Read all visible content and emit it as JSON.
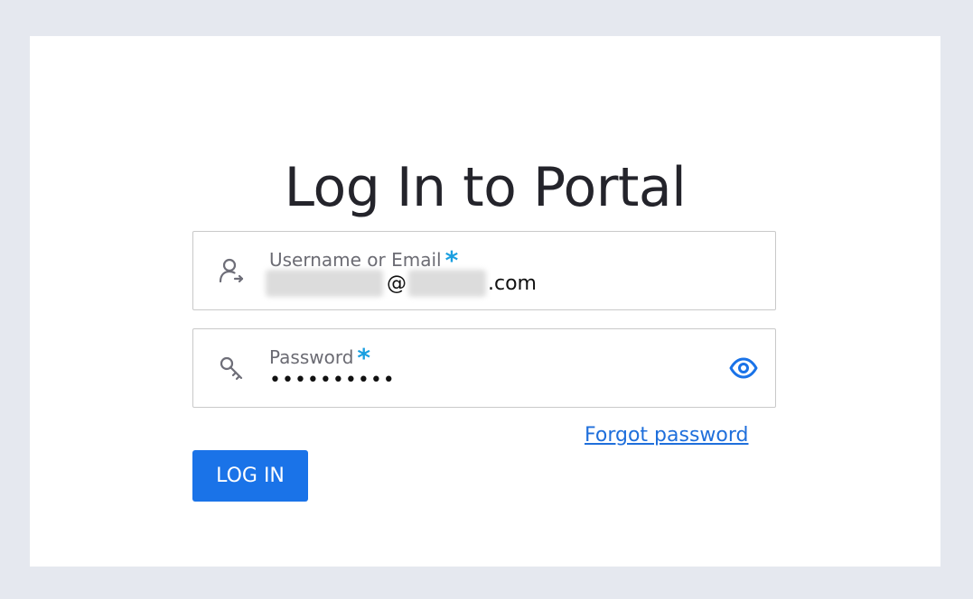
{
  "page": {
    "title": "Log In to Portal"
  },
  "form": {
    "username": {
      "label": "Username or Email",
      "required_mark": "*",
      "at_sign": "@",
      "domain_suffix": ".com",
      "icon": "user-login-icon"
    },
    "password": {
      "label": "Password",
      "required_mark": "*",
      "masked_value": "••••••••••",
      "icon": "key-icon",
      "toggle_icon": "eye-icon"
    },
    "forgot_link": "Forgot password",
    "submit_label": "LOG IN"
  },
  "colors": {
    "background": "#e5e8ef",
    "accent": "#1a73e8",
    "required": "#1a9fe0",
    "link": "#1f6fdb"
  }
}
